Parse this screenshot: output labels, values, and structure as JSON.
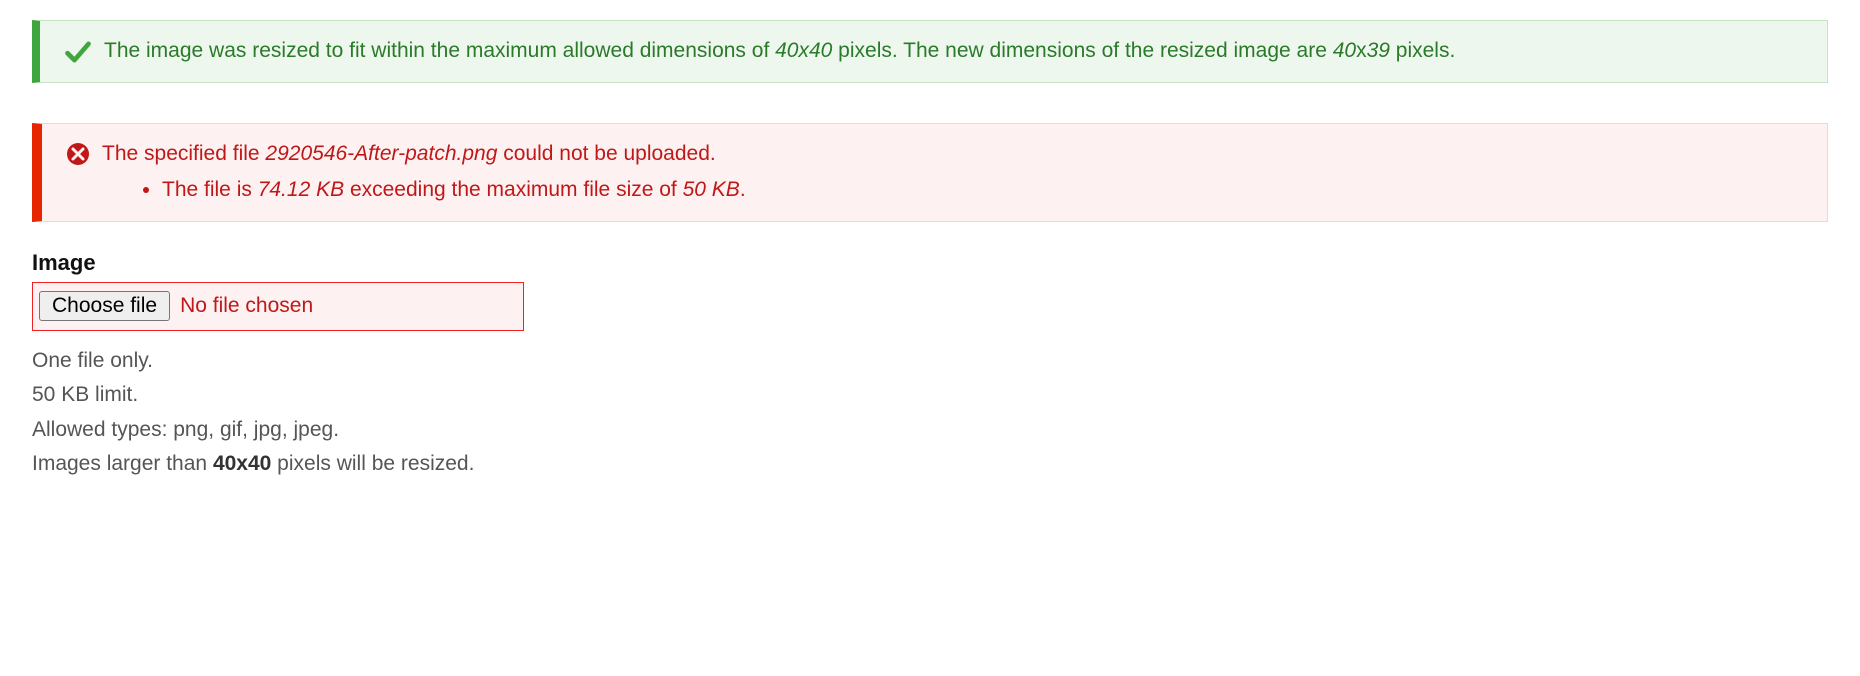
{
  "success_msg": {
    "prefix": "The image was resized to fit within the maximum allowed dimensions of ",
    "max_dim": "40x40",
    "mid": " pixels. The new dimensions of the resized image are ",
    "new_w": "40",
    "x": "x",
    "new_h": "39",
    "suffix": " pixels."
  },
  "error_msg": {
    "prefix": "The specified file ",
    "filename": "2920546-After-patch.png",
    "suffix": " could not be uploaded.",
    "detail_prefix": "The file is ",
    "file_size": "74.12 KB",
    "detail_mid": " exceeding the maximum file size of ",
    "max_size": "50 KB",
    "detail_suffix": "."
  },
  "field": {
    "label": "Image",
    "choose_btn": "Choose file",
    "status": "No file chosen"
  },
  "help": {
    "line1": "One file only.",
    "line2": "50 KB limit.",
    "line3": "Allowed types: png, gif, jpg, jpeg.",
    "line4_prefix": "Images larger than ",
    "line4_dim": "40x40",
    "line4_suffix": " pixels will be resized."
  }
}
